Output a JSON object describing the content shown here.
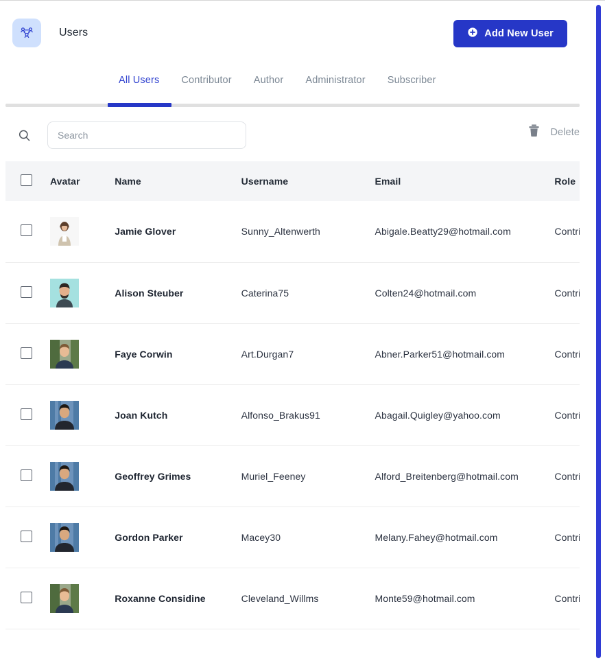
{
  "header": {
    "title": "Users",
    "icon": "users-group-icon",
    "add_button": {
      "label": "Add New User",
      "icon": "plus-circle-icon",
      "color": "#2637c7"
    }
  },
  "tabs": {
    "active": "All Users",
    "items": [
      {
        "label": "All Users"
      },
      {
        "label": "Contributor"
      },
      {
        "label": "Author"
      },
      {
        "label": "Administrator"
      },
      {
        "label": "Subscriber"
      }
    ]
  },
  "toolbar": {
    "search": {
      "icon": "search-icon",
      "placeholder": "Search",
      "value": ""
    },
    "delete": {
      "label": "Delete",
      "icon": "trash-icon"
    }
  },
  "table": {
    "columns": [
      "",
      "Avatar",
      "Name",
      "Username",
      "Email",
      "Role"
    ],
    "rows": [
      {
        "name": "Jamie Glover",
        "username": "Sunny_Altenwerth",
        "email": "Abigale.Beatty29@hotmail.com",
        "role": "Contributor",
        "avatar": "woman-white-background"
      },
      {
        "name": "Alison Steuber",
        "username": "Caterina75",
        "email": "Colten24@hotmail.com",
        "role": "Contributor",
        "avatar": "man-teal-background"
      },
      {
        "name": "Faye Corwin",
        "username": "Art.Durgan7",
        "email": "Abner.Parker51@hotmail.com",
        "role": "Contributor",
        "avatar": "man-green-foliage-background"
      },
      {
        "name": "Joan Kutch",
        "username": "Alfonso_Brakus91",
        "email": "Abagail.Quigley@yahoo.com",
        "role": "Contributor",
        "avatar": "man-blue-locker-background"
      },
      {
        "name": "Geoffrey Grimes",
        "username": "Muriel_Feeney",
        "email": "Alford_Breitenberg@hotmail.com",
        "role": "Contributor",
        "avatar": "man-blue-locker-background"
      },
      {
        "name": "Gordon Parker",
        "username": "Macey30",
        "email": "Melany.Fahey@hotmail.com",
        "role": "Contributor",
        "avatar": "man-blue-locker-background"
      },
      {
        "name": "Roxanne Considine",
        "username": "Cleveland_Willms",
        "email": "Monte59@hotmail.com",
        "role": "Contributor",
        "avatar": "man-green-foliage-background"
      }
    ]
  },
  "scrollbar": {
    "vertical_color": "#2f3bd4"
  }
}
